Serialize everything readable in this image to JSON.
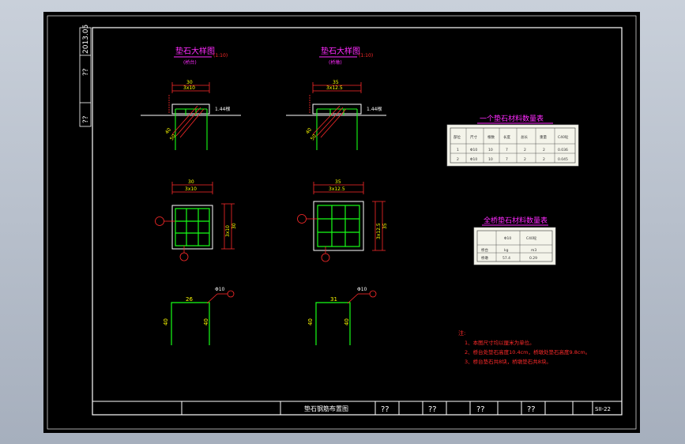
{
  "colors": {
    "paper": "#000000",
    "frame": "#ffffff",
    "red": "#ff2a2a",
    "green": "#17ff17",
    "yellow": "#ffff00",
    "magenta": "#ff2aff",
    "table_bg": "#f4f4ea"
  },
  "side_strip": {
    "date": "2013.05",
    "name": "??",
    "check": "??"
  },
  "views": {
    "left": {
      "title": "垫石大样图",
      "scale": "(1:10)",
      "subtitle": "(桥台)",
      "top_width": "30",
      "top_spacing": "3x10",
      "plan_width": "30",
      "plan_spacing": "3x10",
      "plan_side_total": "30",
      "plan_side_spacing": "3x10",
      "bar_label": "1.44根",
      "bar_dim_1": "40",
      "bar_dim_2": "50",
      "rebar_top": "26",
      "rebar_left": "40",
      "rebar_right": "40",
      "rebar_bar": "Φ10"
    },
    "right": {
      "title": "垫石大样图",
      "scale": "(1:10)",
      "subtitle": "(桥墩)",
      "top_width": "35",
      "top_spacing": "3x12.5",
      "plan_width": "35",
      "plan_spacing": "3x12.5",
      "plan_side_total": "35",
      "plan_side_spacing": "3x12.5",
      "bar_label": "1.44根",
      "bar_dim_1": "40",
      "bar_dim_2": "50",
      "rebar_top": "31",
      "rebar_left": "40",
      "rebar_right": "40",
      "rebar_bar": "Φ10"
    }
  },
  "table1": {
    "title": "一个垫石材料数量表",
    "headers": [
      "部位",
      "尺寸",
      "根数",
      "长度",
      "总长",
      "重量",
      "C40砼"
    ],
    "rows": [
      [
        "1",
        "Φ10",
        "10",
        "7",
        "2",
        "2",
        "0.036"
      ],
      [
        "2",
        "Φ10",
        "10",
        "7",
        "2",
        "2",
        "0.045"
      ]
    ]
  },
  "table2": {
    "title": "全桥垫石材料数量表",
    "headers": [
      "",
      "Φ10",
      "C40砼"
    ],
    "rows": [
      [
        "桥台",
        "kg",
        "m3"
      ],
      [
        "桥墩",
        "57.4",
        "0.29"
      ]
    ]
  },
  "notes": {
    "heading": "注:",
    "items": [
      "1、本图尺寸均以厘米为单位。",
      "2、桥台处垫石高度10.4cm，桥墩处垫石高度9.8cm。",
      "3、桥台垫石共8块，桥墩垫石共8块。"
    ]
  },
  "title_block": {
    "drawing_title": "垫石钢筋布置图",
    "q1": "??",
    "q2": "??",
    "q3": "??",
    "q4": "??",
    "drawing_no": "SII-22"
  }
}
